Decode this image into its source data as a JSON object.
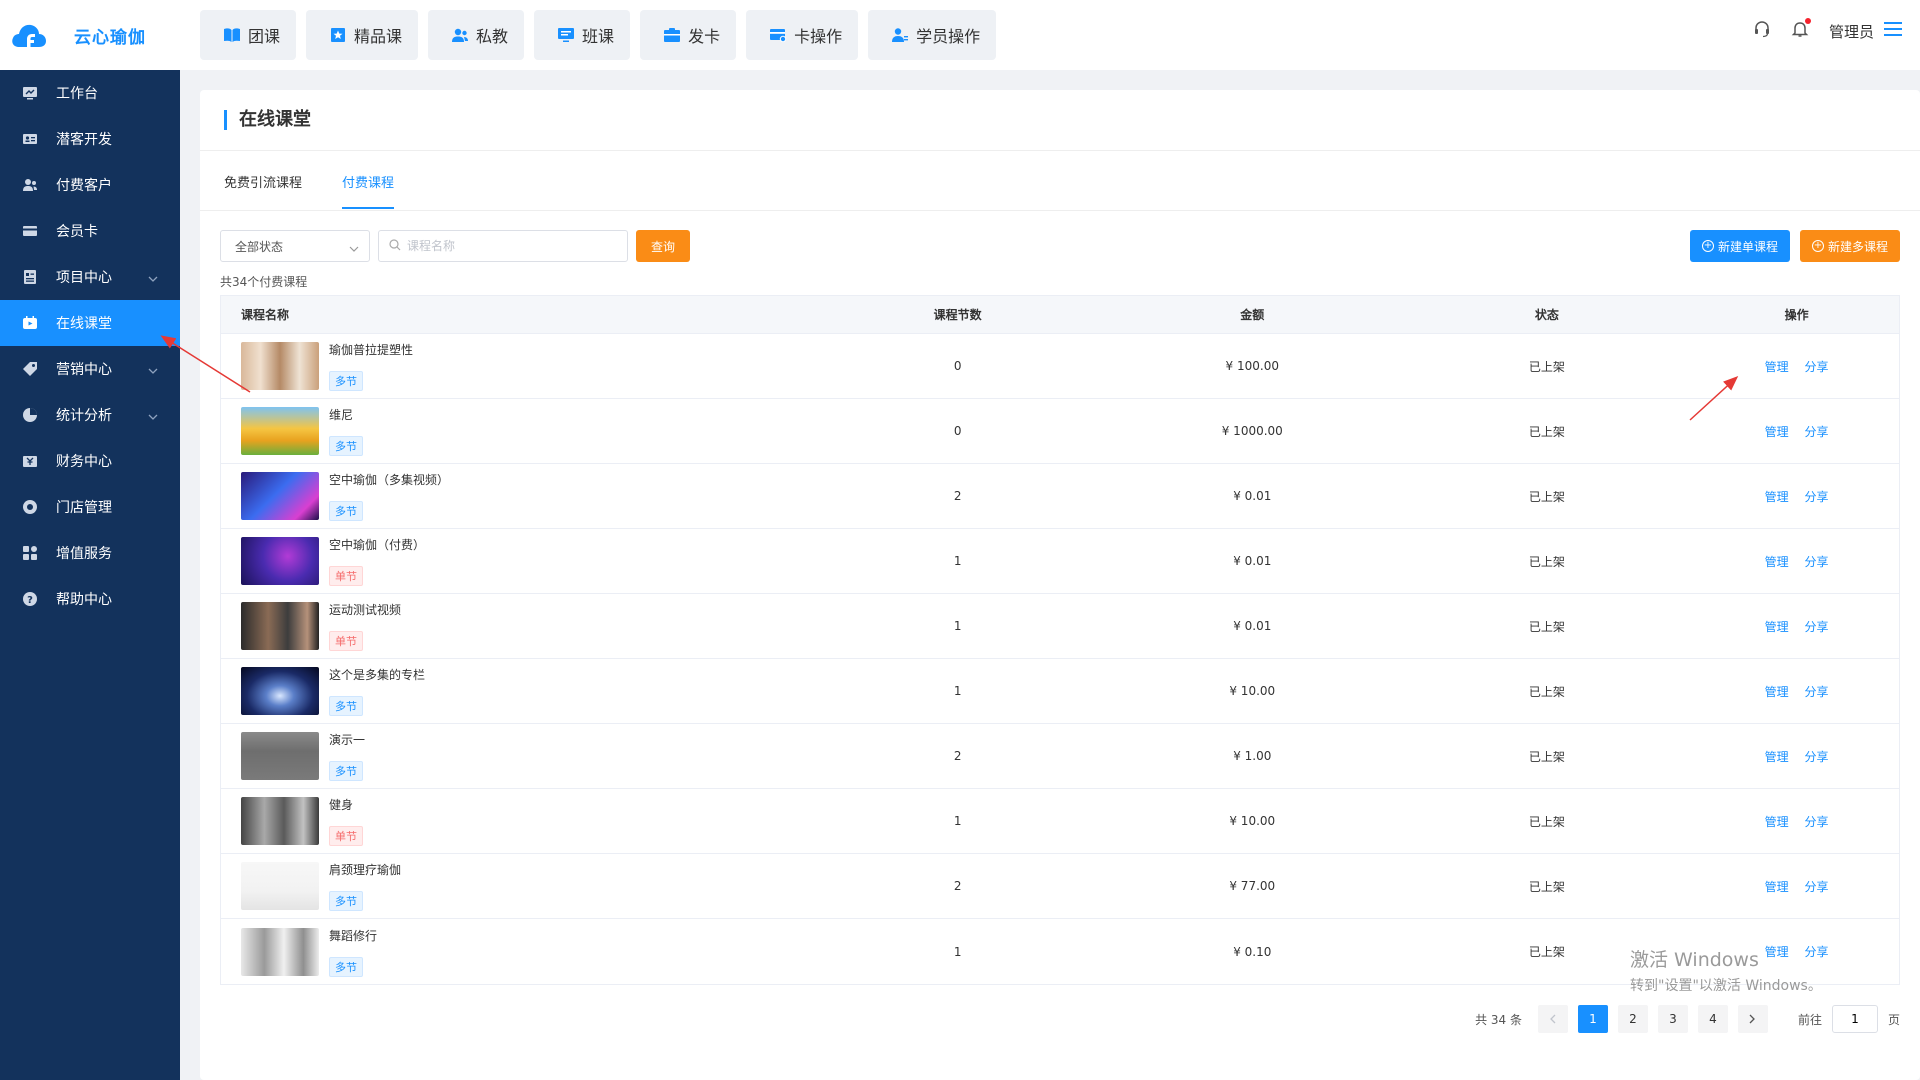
{
  "app": {
    "name": "云心瑜伽"
  },
  "top_nav": [
    {
      "label": "团课",
      "icon": "book-icon"
    },
    {
      "label": "精品课",
      "icon": "star-card-icon"
    },
    {
      "label": "私教",
      "icon": "user-group-icon"
    },
    {
      "label": "班课",
      "icon": "monitor-icon"
    },
    {
      "label": "发卡",
      "icon": "card-icon"
    },
    {
      "label": "卡操作",
      "icon": "card-edit-icon"
    },
    {
      "label": "学员操作",
      "icon": "student-icon"
    }
  ],
  "top_right": {
    "user": "管理员"
  },
  "sidebar": {
    "items": [
      {
        "label": "工作台"
      },
      {
        "label": "潜客开发"
      },
      {
        "label": "付费客户"
      },
      {
        "label": "会员卡"
      },
      {
        "label": "项目中心"
      },
      {
        "label": "在线课堂"
      },
      {
        "label": "营销中心"
      },
      {
        "label": "统计分析"
      },
      {
        "label": "财务中心"
      },
      {
        "label": "门店管理"
      },
      {
        "label": "增值服务"
      },
      {
        "label": "帮助中心"
      }
    ]
  },
  "page": {
    "title": "在线课堂",
    "tabs": [
      "免费引流课程",
      "付费课程"
    ],
    "active_tab": "付费课程"
  },
  "filter": {
    "status_value": "全部状态",
    "search_placeholder": "课程名称",
    "query_label": "查询",
    "new_single_label": "新建单课程",
    "new_multi_label": "新建多课程"
  },
  "summary": "共34个付费课程",
  "table": {
    "headers": [
      "课程名称",
      "课程节数",
      "金额",
      "状态",
      "操作"
    ],
    "rows": [
      {
        "name": "瑜伽普拉提塑性",
        "tag": "多节",
        "lessons": "0",
        "price": "¥ 100.00",
        "status": "已上架",
        "manage": "管理",
        "share": "分享"
      },
      {
        "name": "维尼",
        "tag": "多节",
        "lessons": "0",
        "price": "¥ 1000.00",
        "status": "已上架",
        "manage": "管理",
        "share": "分享"
      },
      {
        "name": "空中瑜伽（多集视频）",
        "tag": "多节",
        "lessons": "2",
        "price": "¥ 0.01",
        "status": "已上架",
        "manage": "管理",
        "share": "分享"
      },
      {
        "name": "空中瑜伽（付费）",
        "tag": "单节",
        "lessons": "1",
        "price": "¥ 0.01",
        "status": "已上架",
        "manage": "管理",
        "share": "分享"
      },
      {
        "name": "运动测试视频",
        "tag": "单节",
        "lessons": "1",
        "price": "¥ 0.01",
        "status": "已上架",
        "manage": "管理",
        "share": "分享"
      },
      {
        "name": "这个是多集的专栏",
        "tag": "多节",
        "lessons": "1",
        "price": "¥ 10.00",
        "status": "已上架",
        "manage": "管理",
        "share": "分享"
      },
      {
        "name": "演示一",
        "tag": "多节",
        "lessons": "2",
        "price": "¥ 1.00",
        "status": "已上架",
        "manage": "管理",
        "share": "分享"
      },
      {
        "name": "健身",
        "tag": "单节",
        "lessons": "1",
        "price": "¥ 10.00",
        "status": "已上架",
        "manage": "管理",
        "share": "分享"
      },
      {
        "name": "肩颈理疗瑜伽",
        "tag": "多节",
        "lessons": "2",
        "price": "¥ 77.00",
        "status": "已上架",
        "manage": "管理",
        "share": "分享"
      },
      {
        "name": "舞蹈修行",
        "tag": "多节",
        "lessons": "1",
        "price": "¥ 0.10",
        "status": "已上架",
        "manage": "管理",
        "share": "分享"
      }
    ]
  },
  "pagination": {
    "total_text": "共 34 条",
    "pages": [
      "1",
      "2",
      "3",
      "4"
    ],
    "current": "1",
    "goto_label": "前往",
    "goto_value": "1",
    "page_suffix": "页"
  },
  "watermark": {
    "line1": "激活 Windows",
    "line2": "转到\"设置\"以激活 Windows。"
  },
  "colors": {
    "sidebar": "#13325c",
    "accent": "#1890ff",
    "orange": "#fa8c16"
  }
}
